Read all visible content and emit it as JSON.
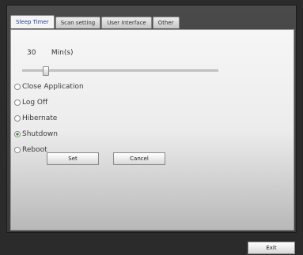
{
  "tabs": [
    {
      "label": "Sleep Timer",
      "active": true
    },
    {
      "label": "Scan setting",
      "active": false
    },
    {
      "label": "User Interface",
      "active": false
    },
    {
      "label": "Other",
      "active": false
    }
  ],
  "timer": {
    "value": "30",
    "unit": "Min(s)",
    "slider_fraction": 0.12
  },
  "options": [
    {
      "label": "Close Application",
      "checked": false
    },
    {
      "label": "Log Off",
      "checked": false
    },
    {
      "label": "Hibernate",
      "checked": false
    },
    {
      "label": "Shutdown",
      "checked": true
    },
    {
      "label": "Reboot",
      "checked": false
    }
  ],
  "buttons": {
    "set": "Set",
    "cancel": "Cancel",
    "exit": "Exit"
  }
}
